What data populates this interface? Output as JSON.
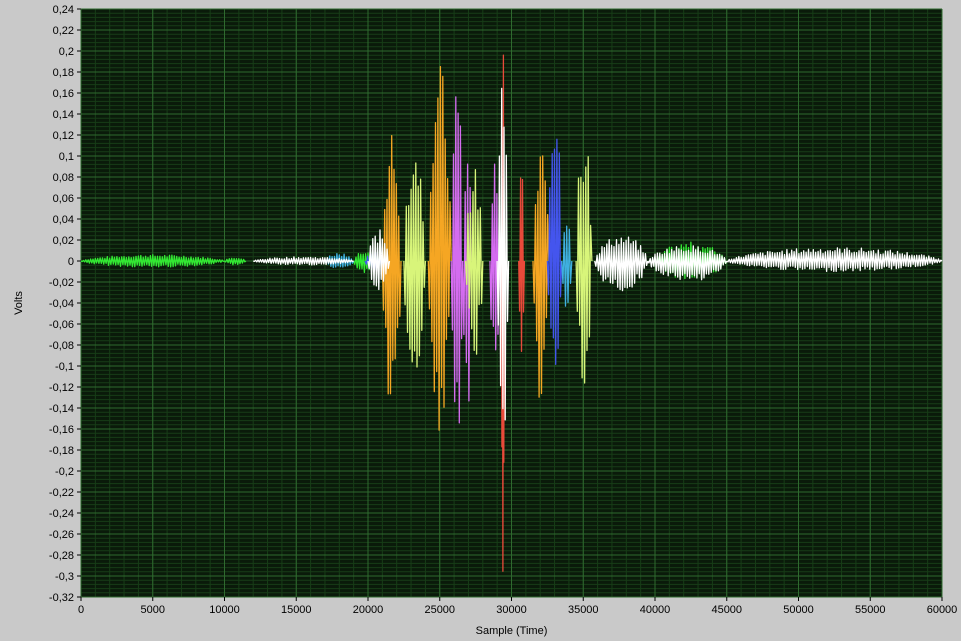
{
  "chart_data": {
    "type": "line",
    "title": "",
    "xlabel": "Sample (Time)",
    "ylabel": "Volts",
    "xlim": [
      0,
      60000
    ],
    "ylim": [
      -0.32,
      0.24
    ],
    "grid": true,
    "background_color": "#0a1a0a",
    "grid_major_color": "#2f6a2f",
    "grid_minor_color": "#173d17",
    "x_ticks": [
      "0",
      "5000",
      "10000",
      "15000",
      "20000",
      "25000",
      "30000",
      "35000",
      "40000",
      "45000",
      "50000",
      "55000",
      "60000"
    ],
    "y_ticks": [
      "0,24",
      "0,22",
      "0,2",
      "0,18",
      "0,16",
      "0,14",
      "0,12",
      "0,1",
      "0,08",
      "0,06",
      "0,04",
      "0,02",
      "0",
      "-0,02",
      "-0,04",
      "-0,06",
      "-0,08",
      "-0,1",
      "-0,12",
      "-0,14",
      "-0,16",
      "-0,18",
      "-0,2",
      "-0,22",
      "-0,24",
      "-0,26",
      "-0,28",
      "-0,3",
      "-0,32"
    ],
    "series": [
      {
        "color": "#33e833",
        "bursts": [
          [
            0,
            10000,
            0.006,
            -0.006
          ],
          [
            10000,
            11500,
            0.004,
            -0.004
          ],
          [
            19000,
            21000,
            0.012,
            -0.012
          ],
          [
            40000,
            45000,
            0.018,
            -0.018
          ]
        ]
      },
      {
        "color": "#f5a623",
        "bursts": [
          [
            21000,
            22300,
            0.125,
            -0.16
          ],
          [
            24200,
            25800,
            0.19,
            -0.17
          ],
          [
            31500,
            32600,
            0.12,
            -0.14
          ]
        ]
      },
      {
        "color": "#d46cf0",
        "bursts": [
          [
            25800,
            26600,
            0.2,
            -0.19
          ],
          [
            26600,
            27200,
            0.13,
            -0.16
          ],
          [
            28500,
            29300,
            0.1,
            -0.12
          ]
        ]
      },
      {
        "color": "#d8f57a",
        "bursts": [
          [
            22500,
            24000,
            0.12,
            -0.13
          ],
          [
            26800,
            28000,
            0.09,
            -0.1
          ],
          [
            34500,
            35600,
            0.13,
            -0.14
          ]
        ]
      },
      {
        "color": "#4455ee",
        "bursts": [
          [
            32500,
            33500,
            0.16,
            -0.13
          ],
          [
            19800,
            21000,
            0.012,
            -0.012
          ]
        ]
      },
      {
        "color": "#3fb0e0",
        "bursts": [
          [
            33500,
            34200,
            0.05,
            -0.05
          ],
          [
            17000,
            19000,
            0.008,
            -0.008
          ]
        ]
      },
      {
        "color": "#e84a3a",
        "bursts": [
          [
            29300,
            29500,
            0.235,
            -0.3
          ],
          [
            30500,
            30900,
            0.09,
            -0.1
          ]
        ]
      },
      {
        "color": "#ffffff",
        "bursts": [
          [
            12000,
            19000,
            0.004,
            -0.004
          ],
          [
            20000,
            21500,
            0.03,
            -0.03
          ],
          [
            29000,
            29800,
            0.22,
            -0.2
          ],
          [
            35800,
            39500,
            0.025,
            -0.03
          ],
          [
            39500,
            45000,
            0.015,
            -0.02
          ],
          [
            45000,
            60000,
            0.013,
            -0.01
          ]
        ]
      }
    ]
  }
}
